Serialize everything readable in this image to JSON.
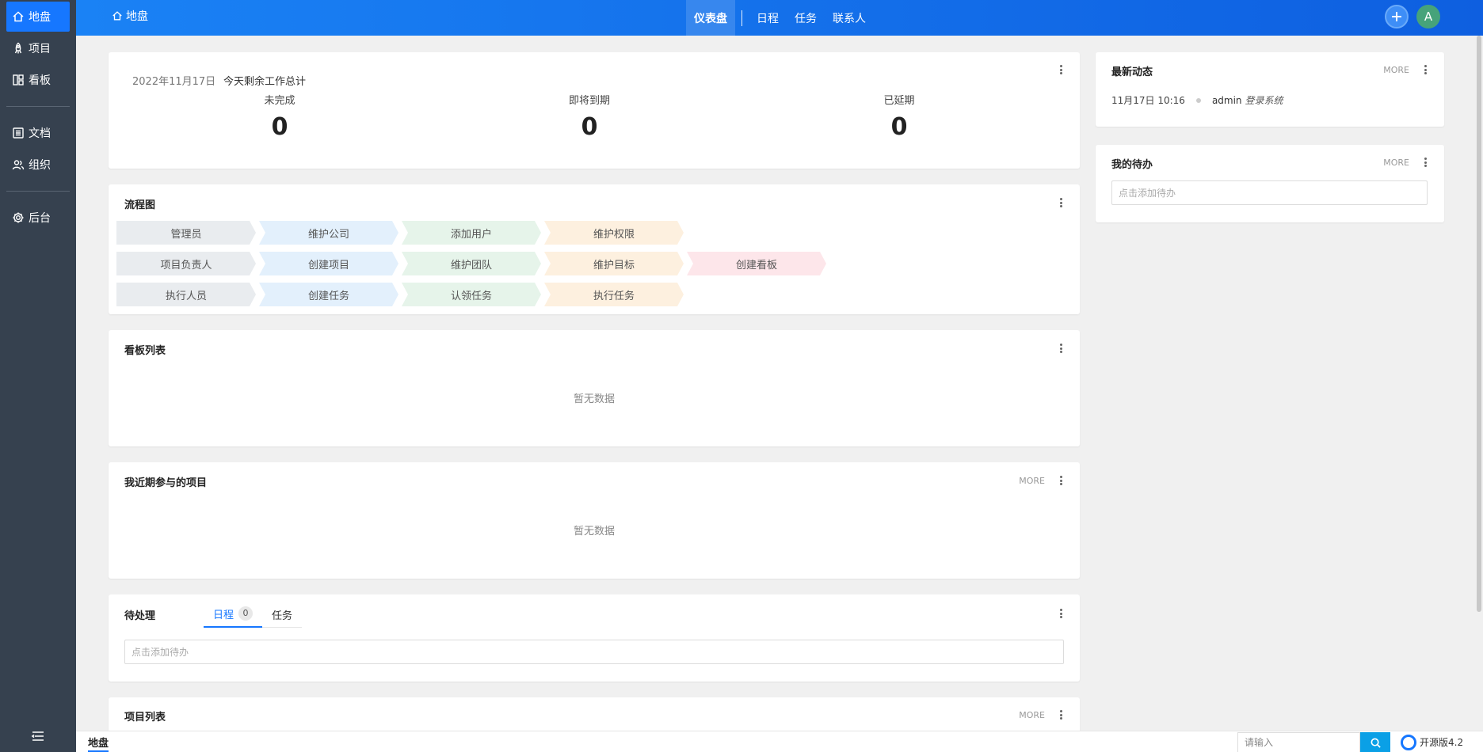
{
  "sidebar": {
    "items": [
      {
        "label": "地盘",
        "icon": "home-icon"
      },
      {
        "label": "项目",
        "icon": "rocket-icon"
      },
      {
        "label": "看板",
        "icon": "board-icon"
      },
      {
        "label": "文档",
        "icon": "document-icon"
      },
      {
        "label": "组织",
        "icon": "users-icon"
      },
      {
        "label": "后台",
        "icon": "gear-icon"
      }
    ]
  },
  "topbar": {
    "home_label": "地盘",
    "nav": [
      "仪表盘",
      "日程",
      "任务",
      "联系人"
    ],
    "avatar_letter": "A"
  },
  "stats_card": {
    "date": "2022年11月17日",
    "desc": "今天剩余工作总计",
    "items": [
      {
        "label": "未完成",
        "value": "0"
      },
      {
        "label": "即将到期",
        "value": "0"
      },
      {
        "label": "已延期",
        "value": "0"
      }
    ]
  },
  "flow_card": {
    "title": "流程图",
    "rows": [
      [
        "管理员",
        "维护公司",
        "添加用户",
        "维护权限"
      ],
      [
        "项目负责人",
        "创建项目",
        "维护团队",
        "维护目标",
        "创建看板"
      ],
      [
        "执行人员",
        "创建任务",
        "认领任务",
        "执行任务"
      ]
    ]
  },
  "board_card": {
    "title": "看板列表",
    "empty": "暂无数据"
  },
  "recent_projects_card": {
    "title": "我近期参与的项目",
    "more": "MORE",
    "empty": "暂无数据"
  },
  "pending_card": {
    "title": "待处理",
    "tabs": [
      {
        "label": "日程",
        "count": "0"
      },
      {
        "label": "任务"
      }
    ],
    "input_placeholder": "点击添加待办"
  },
  "project_list_card": {
    "title": "项目列表",
    "more": "MORE"
  },
  "activity_card": {
    "title": "最新动态",
    "more": "MORE",
    "entries": [
      {
        "time": "11月17日 10:16",
        "user": "admin",
        "action": "登录系统"
      }
    ]
  },
  "todo_card": {
    "title": "我的待办",
    "more": "MORE",
    "input_placeholder": "点击添加待办"
  },
  "bottombar": {
    "tab": "地盘",
    "search_placeholder": "请输入",
    "version": "开源版4.2"
  },
  "colors": {
    "accent": "#1677ff",
    "sidebar_bg": "#36414f",
    "topbar_start": "#1a82f5",
    "topbar_end": "#0e5fe0"
  }
}
